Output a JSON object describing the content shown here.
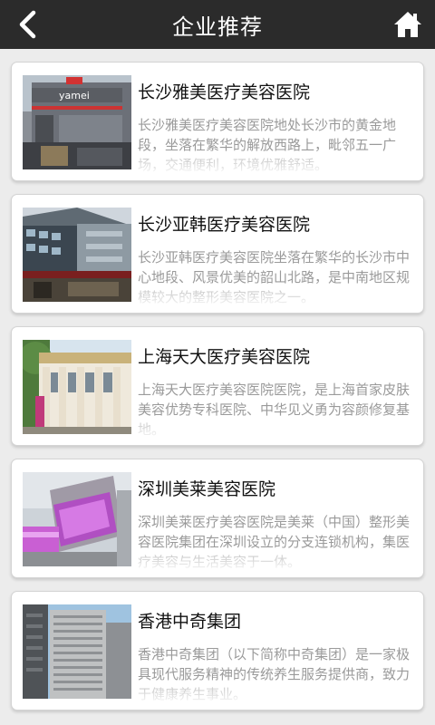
{
  "header": {
    "title": "企业推荐"
  },
  "items": [
    {
      "title": "长沙雅美医疗美容医院",
      "desc": "长沙雅美医疗美容医院地处长沙市的黄金地段，坐落在繁华的解放西路上，毗邻五一广场，交通便利，环境优雅舒适。",
      "sign_text": "yamei"
    },
    {
      "title": "长沙亚韩医疗美容医院",
      "desc": "长沙亚韩医疗美容医院坐落在繁华的长沙市中心地段、风景优美的韶山北路，是中南地区规模较大的整形美容医院之一。"
    },
    {
      "title": "上海天大医疗美容医院",
      "desc": "上海天大医疗美容医院医院，是上海首家皮肤美容优势专科医院、中华见义勇为容颜修复基地。"
    },
    {
      "title": "深圳美莱美容医院",
      "desc": "深圳美莱医疗美容医院是美莱（中国）整形美容医院集团在深圳设立的分支连锁机构，集医疗美容与生活美容于一体。"
    },
    {
      "title": "香港中奇集团",
      "desc": "香港中奇集团（以下简称中奇集团）是一家极具现代服务精神的传统养生服务提供商，致力于健康养生事业。"
    }
  ],
  "colors": {
    "topbar": "#2b2b2b",
    "card_bg": "#ffffff",
    "desc": "#9a9a9a"
  }
}
